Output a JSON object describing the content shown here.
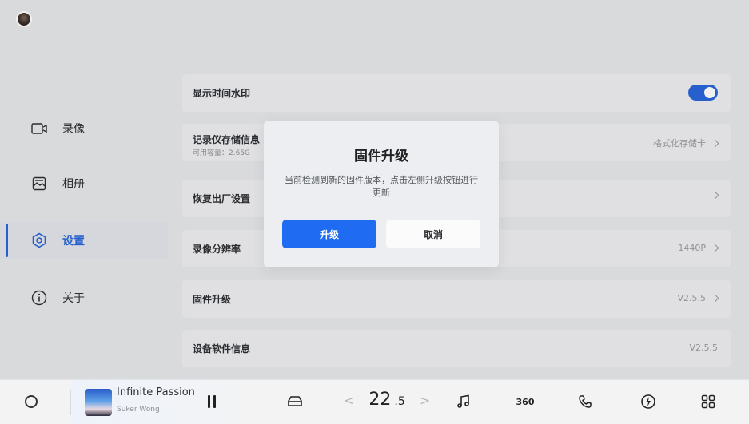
{
  "sidebar": {
    "items": [
      {
        "label": "录像",
        "icon": "video-icon"
      },
      {
        "label": "相册",
        "icon": "album-icon"
      },
      {
        "label": "设置",
        "icon": "settings-icon"
      },
      {
        "label": "关于",
        "icon": "info-icon"
      }
    ],
    "active_index": 2
  },
  "settings": {
    "watermark": {
      "title": "显示时间水印",
      "enabled": true
    },
    "storage": {
      "title": "记录仪存储信息",
      "sub": "可用容量：2.65G",
      "action": "格式化存储卡"
    },
    "factory_reset": {
      "title": "恢复出厂设置"
    },
    "resolution": {
      "title": "录像分辨率",
      "value": "1440P"
    },
    "firmware": {
      "title": "固件升级",
      "value": "V2.5.5"
    },
    "software_info": {
      "title": "设备软件信息",
      "value": "V2.5.5"
    }
  },
  "modal": {
    "title": "固件升级",
    "body": "当前检测到新的固件版本，点击左侧升级按钮进行更新",
    "confirm_label": "升级",
    "cancel_label": "取消"
  },
  "bottom_bar": {
    "song_title": "Infinite Passion",
    "artist": "Suker Wong",
    "temperature_int": "22",
    "temperature_dec": ".5",
    "temp_left": "<",
    "temp_right": ">",
    "icons": [
      "home-circle-icon",
      "pause-icon",
      "car-seat-icon",
      "music-icon",
      "camera-360-icon",
      "phone-icon",
      "power-icon",
      "apps-grid-icon"
    ],
    "camera_label": "360"
  },
  "colors": {
    "accent": "#2a66d9",
    "primary_button": "#1f6cf2"
  }
}
